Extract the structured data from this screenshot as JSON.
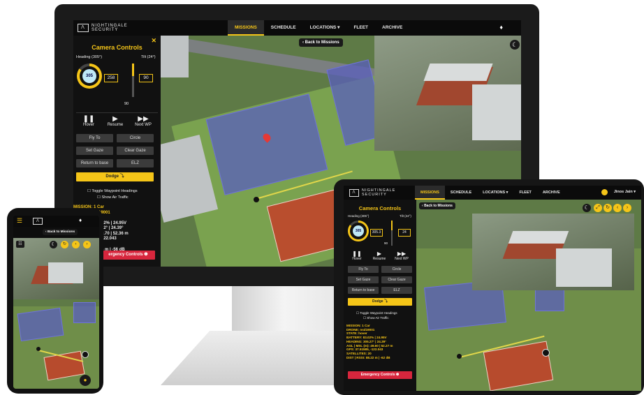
{
  "brand": {
    "line1": "NIGHTINGALE",
    "line2": "SECURITY"
  },
  "nav": {
    "items": [
      "MISSIONS",
      "SCHEDULE",
      "LOCATIONS ▾",
      "FLEET",
      "ARCHIVE"
    ],
    "tablet_items": [
      "MISSIONS",
      "SCHEDULE",
      "LOCATIONS ▾",
      "FLEET",
      "ARCHIVE"
    ],
    "user": "Jinos Jain ▾"
  },
  "back": "Back to Missions",
  "panel": {
    "title": "Camera Controls",
    "heading_label": "Heading (305°)",
    "tilt_label": "Tilt (24°)",
    "heading_gauge": "305",
    "heading_value": "258",
    "tilt_value": "90",
    "tilt_bottom": "90",
    "tablet_heading_value": "305.3",
    "tablet_tilt_value": "24",
    "hover": "Hover",
    "resume": "Resume",
    "next_wp": "Next WP",
    "fly_to": "Fly To",
    "circle": "Circle",
    "set_gaze": "Set Gaze",
    "clear_gaze": "Clear Gaze",
    "return_to_base": "Return to base",
    "elz": "ELZ",
    "dodge": "Dodge ⤵",
    "toggle_waypoint": "Toggle Waypoint Headings",
    "show_air_traffic": "Show Air Traffic",
    "emergency": "Emergency Controls ❶",
    "emergency_short": "ergency Controls ❶"
  },
  "telemetry": {
    "mission": "MISSION: 1 Car",
    "drone": "DRONE: nsd19001",
    "state": "STATE: hover",
    "battery": "BATTERY: 83.02% | 24.95V",
    "heading": "HEADING: 305.27° | 24.39°",
    "agl": "AGL | MSL (m): 49.60 | 52.27 m",
    "gps": "GPS: 37.51585, -122.043",
    "satellites": "SATELLITES: 20",
    "dist": "DIST | RSSI: 88.22 m | -62 dB"
  },
  "telemetry_partial": {
    "battery": "02% | 24.95V",
    "heading": "22° | 24.39°",
    "agl": "9.70 | 52.36 m",
    "gps": "122.043",
    "dist": "5 m | -56 dB"
  },
  "icons": {
    "menu": "☰",
    "bell": "🔔",
    "moon": "☾",
    "close": "✕"
  }
}
